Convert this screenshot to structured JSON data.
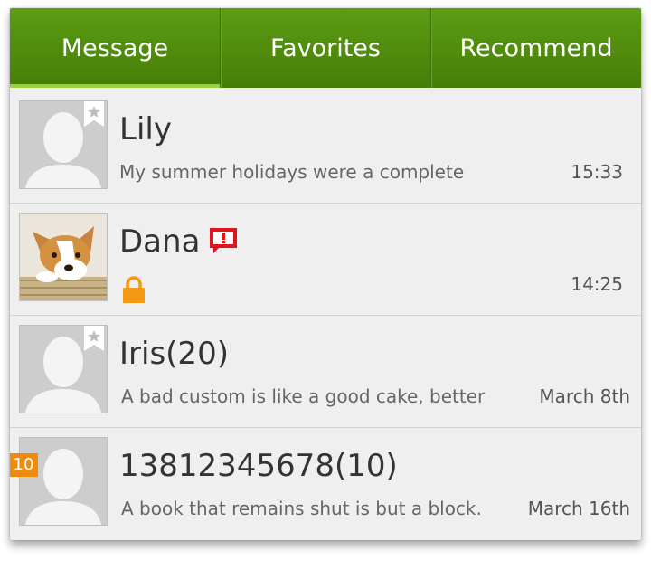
{
  "tabs": [
    {
      "label": "Message",
      "active": true
    },
    {
      "label": "Favorites",
      "active": false
    },
    {
      "label": "Recommend",
      "active": false
    }
  ],
  "colors": {
    "header_green": "#4f8a0c",
    "active_indicator": "#9ad13d",
    "alert_red": "#e0141e",
    "lock_orange": "#f39a12",
    "badge_orange": "#f08a0a"
  },
  "conversations": [
    {
      "name": "Lily",
      "preview": "My summer holidays were a complete",
      "time": "15:33",
      "avatar": "default-avatar",
      "starred": true
    },
    {
      "name": "Dana",
      "preview": "",
      "time": "14:25",
      "avatar": "corgi-photo",
      "icons": [
        "alert-icon",
        "lock-icon"
      ]
    },
    {
      "name": "Iris(20)",
      "preview": "A bad custom is like a good cake, better",
      "time": "March 8th",
      "avatar": "default-avatar",
      "starred": true
    },
    {
      "name": "13812345678(10)",
      "preview": "A book that remains shut is but a block.",
      "time": "March 16th",
      "avatar": "default-avatar",
      "badge": "10"
    }
  ]
}
